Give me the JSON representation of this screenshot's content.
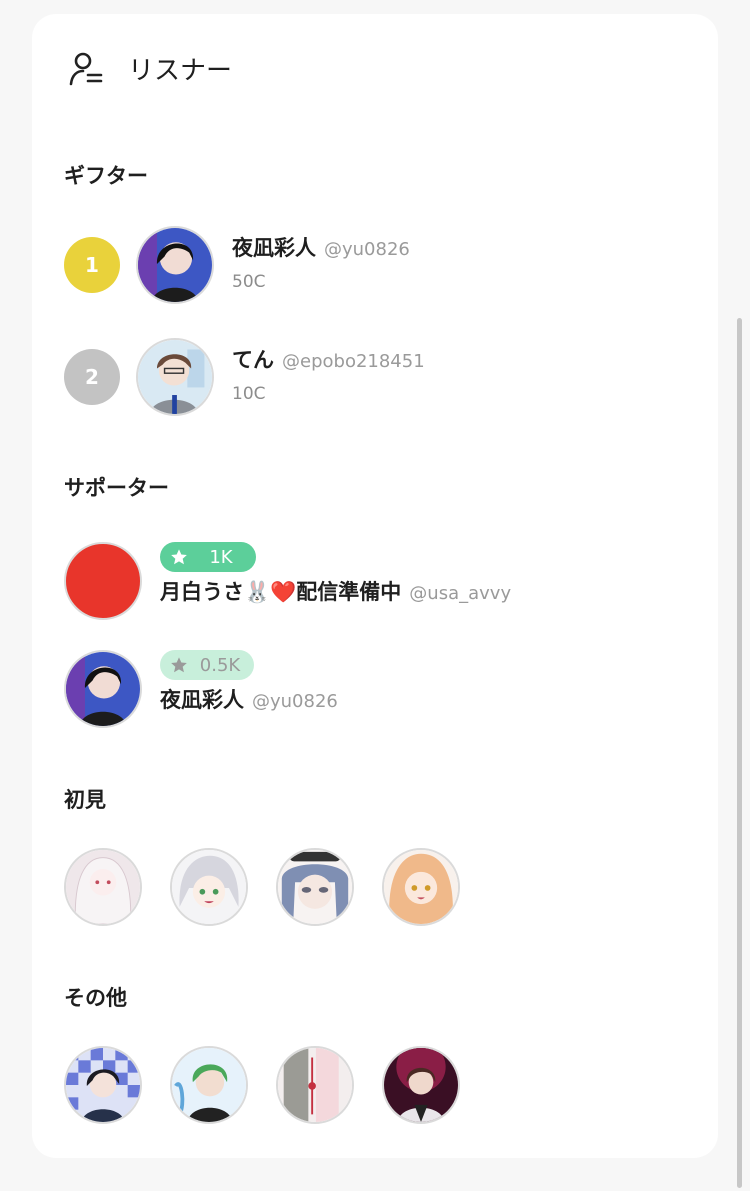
{
  "header": {
    "title": "リスナー",
    "icon": "user-list-icon"
  },
  "sections": {
    "gifter": "ギフター",
    "supporter": "サポーター",
    "first_time": "初見",
    "others": "その他"
  },
  "gifters": [
    {
      "rank": "1",
      "name": "夜凪彩人",
      "handle": "@yu0826",
      "amount": "50C",
      "rank_color": "#e9d23b"
    },
    {
      "rank": "2",
      "name": "てん",
      "handle": "@epobo218451",
      "amount": "10C",
      "rank_color": "#c3c3c3"
    }
  ],
  "supporters": [
    {
      "badge": "1K",
      "name": "月白うさ🐰❤️配信準備中",
      "handle": "@usa_avvy",
      "badge_color": "#5ccf9a",
      "avatar_color": "#e8352b"
    },
    {
      "badge": "0.5K",
      "name": "夜凪彩人",
      "handle": "@yu0826",
      "badge_color": "#c8efdb"
    }
  ],
  "colors": {
    "accent_green": "#5ccf9a",
    "gold": "#e9d23b",
    "silver": "#c3c3c3"
  }
}
